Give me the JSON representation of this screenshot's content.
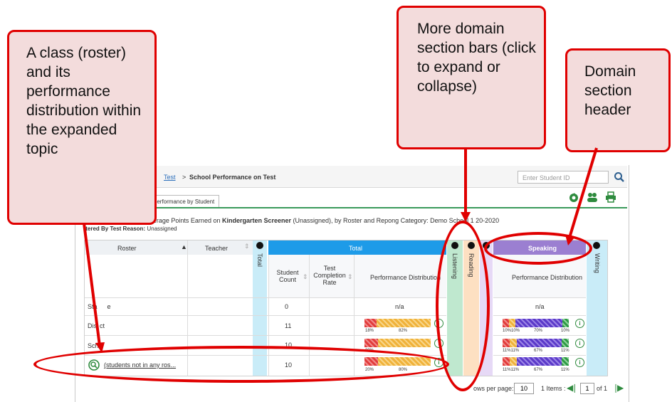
{
  "header": {
    "breadcrumb_link": "Test",
    "breadcrumb_sep": ">",
    "breadcrumb_current": "School Performance on Test",
    "search_placeholder": "Enter Student ID"
  },
  "tabs": {
    "active": "Performance by Student"
  },
  "report": {
    "description_prefix": "ance Distribution and Average Points Earned on ",
    "test_name": "Kindergarten Screener",
    "description_suffix": " (Unassigned), by Roster and Repo",
    "description_tail": "ng Category: Demo School 1 20",
    "description_end": "-2020",
    "filter_label": "ltered By ",
    "filter_key": "Test Reason:",
    "filter_value": "Unassigned"
  },
  "table": {
    "col_roster": "Roster",
    "col_teacher": "Teacher",
    "col_total_vertical": "Total",
    "group_total": "Total",
    "col_student_count": "Student Count",
    "col_completion": "Test Completion Rate",
    "col_perf": "Performance Distribution",
    "domain_listening": "Listening",
    "domain_reading": "Reading",
    "domain_speaking": "Speaking",
    "domain_writing": "Writing",
    "speaking_perf": "Performance Distribution",
    "rows": [
      {
        "name": "Sta",
        "tail": "e",
        "count": "0",
        "total_na": "n/a",
        "speak_na": "n/a"
      },
      {
        "name": "Dis",
        "tail": "ct",
        "count": "11",
        "t1": "18%",
        "t2": "82%",
        "s1": "10%10%",
        "s2": "70%",
        "s3": "10%"
      },
      {
        "name": "Sch",
        "tail": "",
        "count": "10",
        "t1": "20%",
        "s1": "11%11%",
        "s2": "67%",
        "s3": "11%"
      },
      {
        "name": "(students not in any ros",
        "tail": "...",
        "count": "10",
        "t1": "20%",
        "t2": "80%",
        "s1": "11%11%",
        "s2": "67%",
        "s3": "11%"
      }
    ]
  },
  "pagination": {
    "label": "ows per page:",
    "per_page": "10",
    "items": "1 Items :",
    "page": "1",
    "of": "of 1"
  },
  "callouts": {
    "roster": "A class (roster) and its performance distribution within the expanded topic",
    "domain_bars": "More domain section bars (click to expand or collapse)",
    "domain_header": "Domain section header"
  },
  "colors": {
    "total_header": "#1e9be8",
    "listening": "#bfe8cf",
    "reading": "#fde0c2",
    "speaking": "#9b7fd1",
    "writing": "#c9ecf8",
    "callout_fill": "#f3dcdc",
    "callout_border": "#e00000"
  }
}
